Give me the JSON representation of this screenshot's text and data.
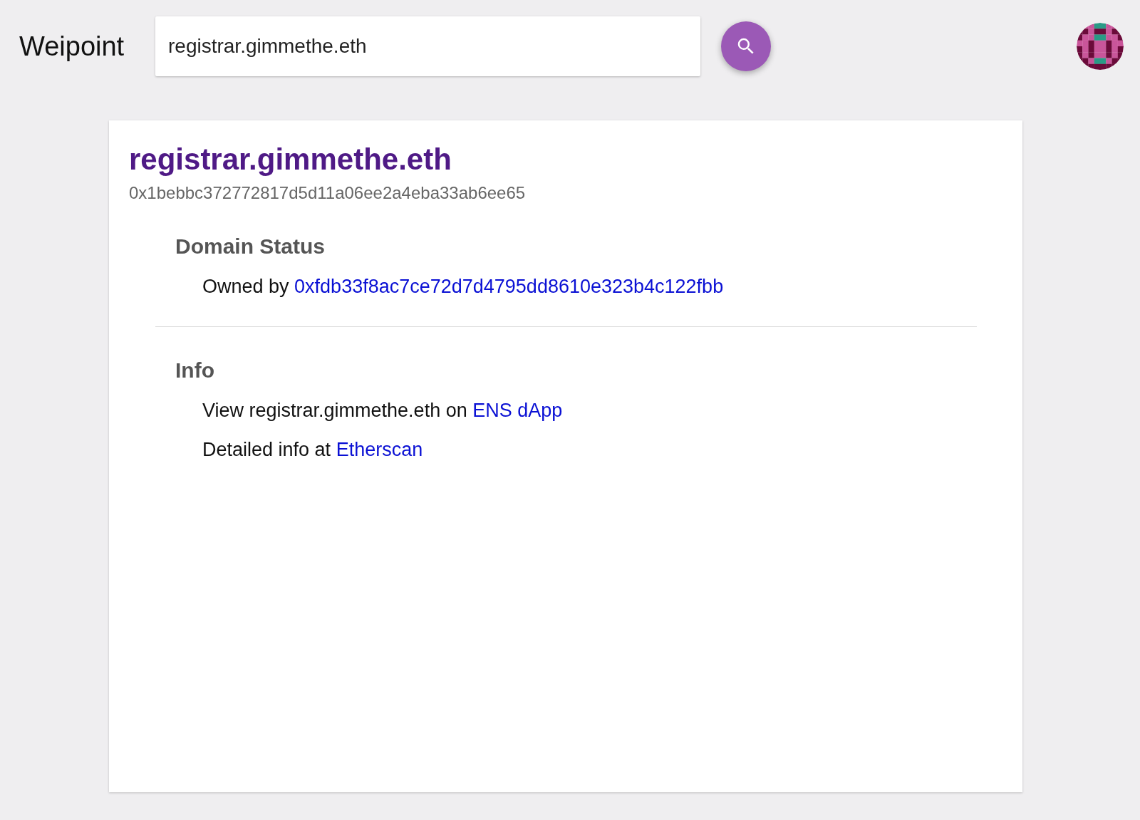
{
  "header": {
    "logo": "Weipoint",
    "search": {
      "value": "registrar.gimmethe.eth"
    }
  },
  "result": {
    "name": "registrar.gimmethe.eth",
    "hash": "0x1bebbc372772817d5d11a06ee2a4eba33ab6ee65",
    "sections": [
      {
        "heading": "Domain Status",
        "lines": [
          {
            "text": "Owned by ",
            "link": "0xfdb33f8ac7ce72d7d4795dd8610e323b4c122fbb"
          }
        ]
      },
      {
        "heading": "Info",
        "lines": [
          {
            "text": "View registrar.gimmethe.eth on ",
            "link": "ENS dApp"
          },
          {
            "text": "Detailed info at ",
            "link": "Etherscan"
          }
        ]
      }
    ]
  }
}
